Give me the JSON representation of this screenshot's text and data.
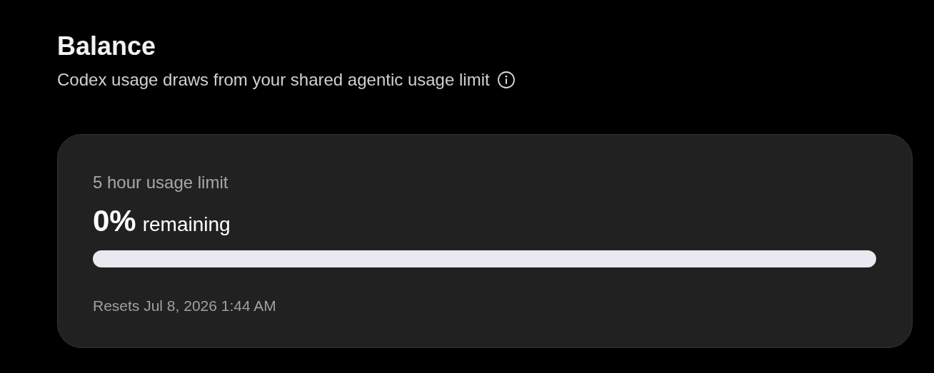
{
  "title": "Balance",
  "subtitle": "Codex usage draws from your shared agentic usage limit",
  "limit_card": {
    "label": "5 hour usage limit",
    "percent": "0%",
    "percent_suffix": "remaining",
    "level": 0,
    "resets": "Resets Jul 8, 2026 1:44 AM"
  }
}
